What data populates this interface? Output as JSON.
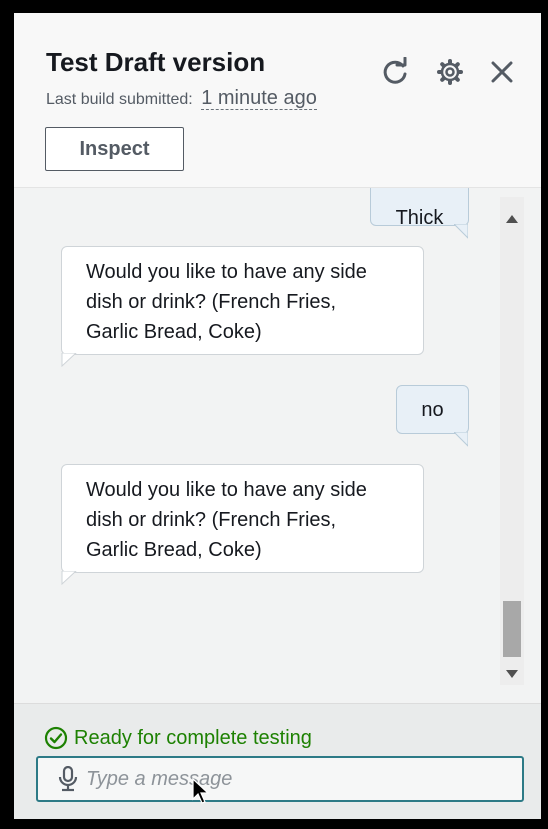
{
  "header": {
    "title": "Test Draft version",
    "subtitle_prefix": "Last build submitted:",
    "subtitle_time": "1 minute ago",
    "inspect_label": "Inspect",
    "icons": [
      "refresh-icon",
      "gear-icon",
      "close-icon"
    ]
  },
  "conversation": {
    "messages": [
      {
        "sender": "user",
        "text": "Thick"
      },
      {
        "sender": "bot",
        "lines": [
          "Would you like to have any side",
          "dish or drink? (French Fries,",
          "Garlic Bread, Coke)"
        ]
      },
      {
        "sender": "user",
        "text": "no"
      },
      {
        "sender": "bot",
        "lines": [
          "Would you like to have any side",
          "dish or drink? (French Fries,",
          "Garlic Bread, Coke)"
        ]
      }
    ]
  },
  "footer": {
    "status": "Ready for complete testing",
    "input_placeholder": "Type a message",
    "input_value": ""
  },
  "colors": {
    "success": "#1d8102",
    "input_border": "#2d7a86",
    "user_bubble": "#e8f0f7"
  }
}
